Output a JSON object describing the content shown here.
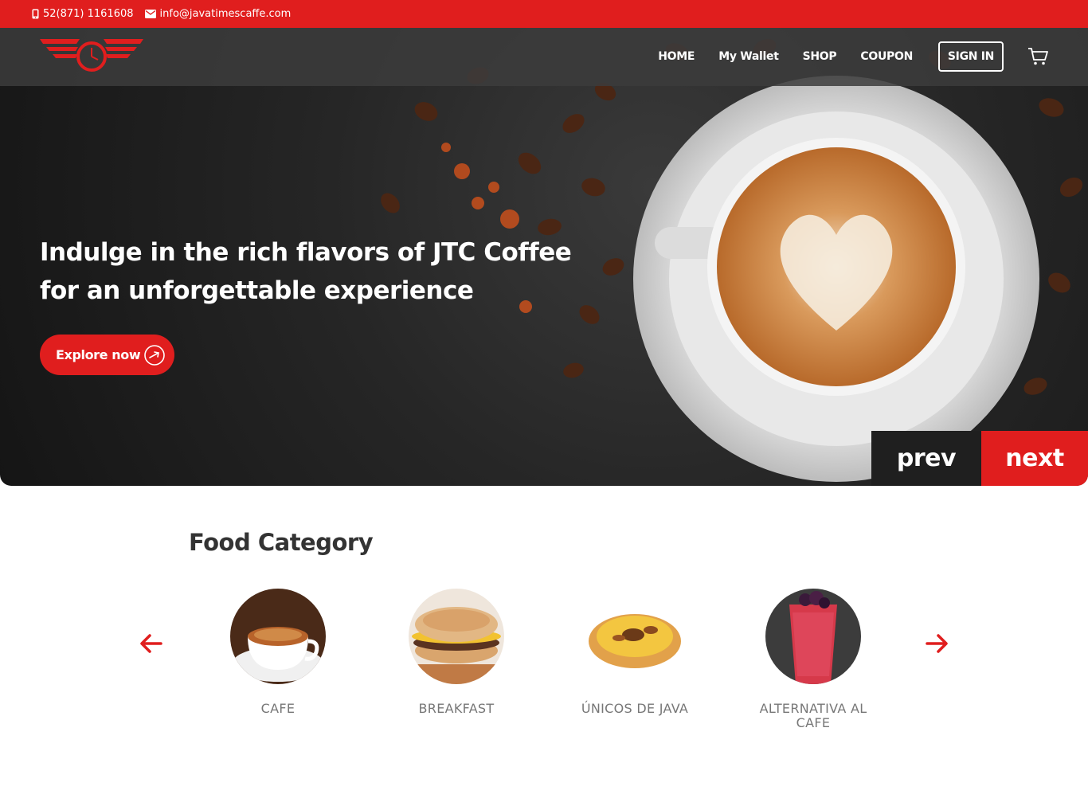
{
  "topbar": {
    "phone": "52(871) 1161608",
    "email": "info@javatimescaffe.com",
    "phone_icon": "phone-icon",
    "email_icon": "envelope-icon"
  },
  "nav": {
    "logo": "winged-clock-logo",
    "items": [
      "HOME",
      "My Wallet",
      "SHOP",
      "COUPON"
    ],
    "signin": "SIGN IN",
    "cart_icon": "cart-icon"
  },
  "hero": {
    "headline_line1": "Indulge in the rich flavors of JTC Coffee",
    "headline_line2": "for an unforgettable experience",
    "cta": "Explore now",
    "prev": "prev",
    "next": "next"
  },
  "categories": {
    "title": "Food Category",
    "items": [
      {
        "label": "CAFE",
        "image": "coffee-cup-image"
      },
      {
        "label": "BREAKFAST",
        "image": "breakfast-sandwich-image"
      },
      {
        "label": "ÚNICOS DE JAVA",
        "image": "egg-tart-image"
      },
      {
        "label": "ALTERNATIVA AL CAFE",
        "image": "berry-smoothie-image"
      }
    ]
  },
  "colors": {
    "brand_red": "#e01e1e",
    "dark": "#1f1f1f",
    "text_gray": "#777777"
  }
}
